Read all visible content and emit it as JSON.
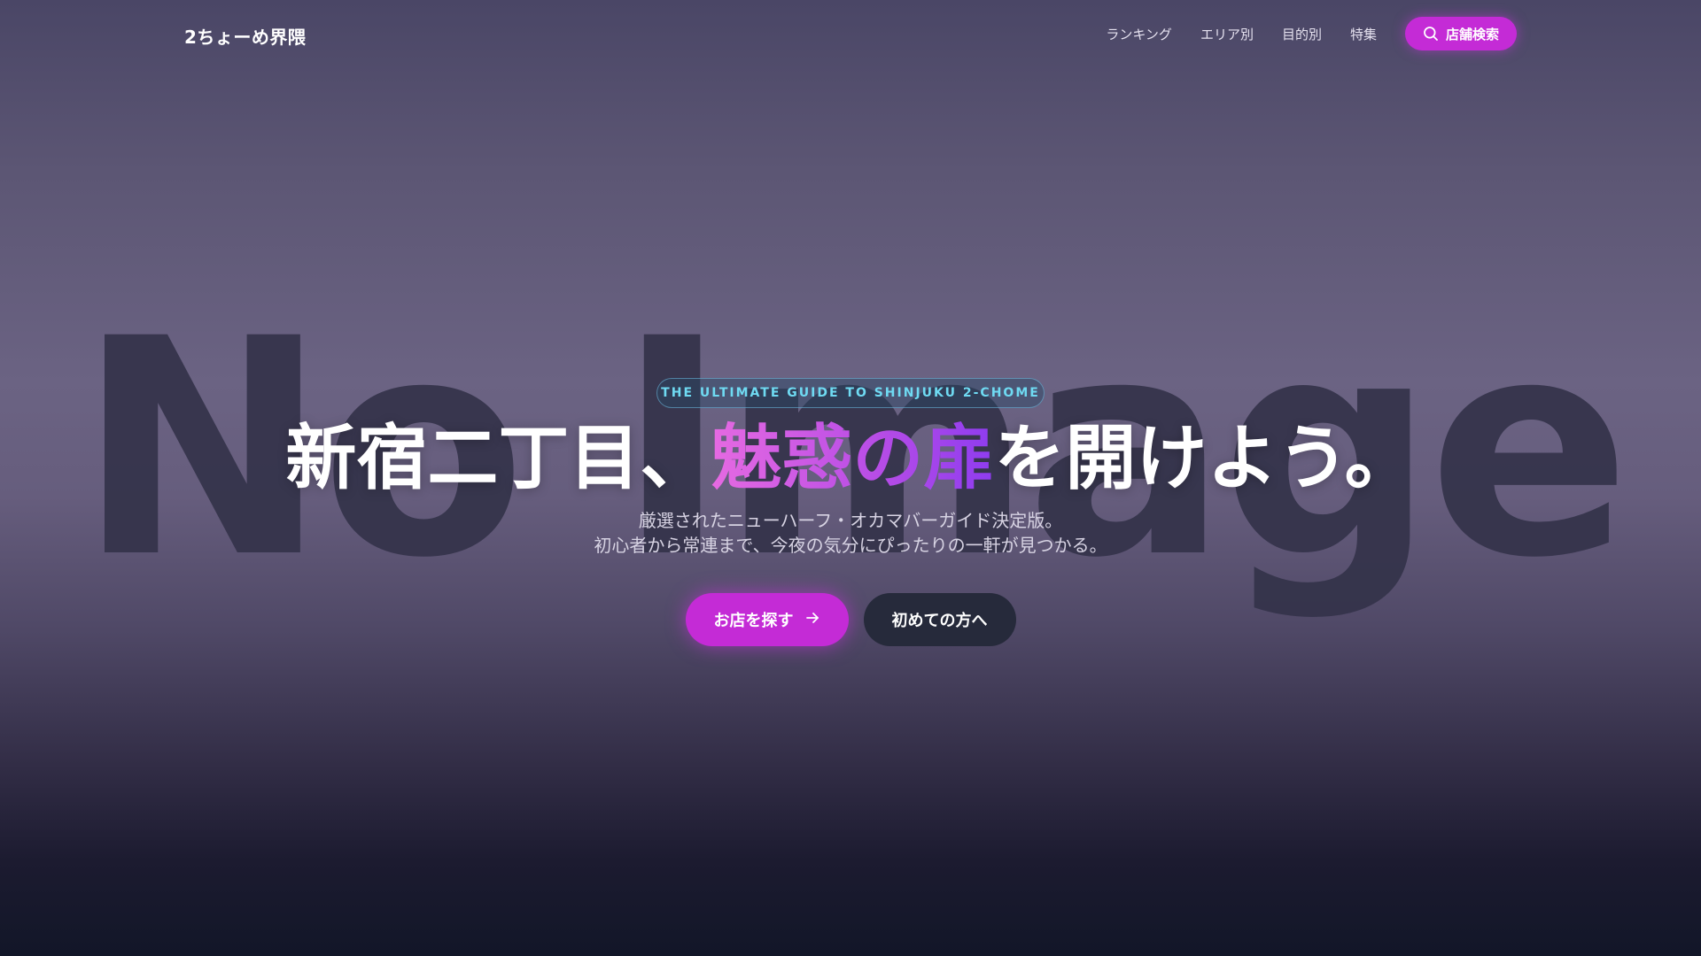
{
  "header": {
    "logo": "2ちょーめ界隈",
    "nav": [
      {
        "label": "ランキング"
      },
      {
        "label": "エリア別"
      },
      {
        "label": "目的別"
      },
      {
        "label": "特集"
      }
    ],
    "search_button": {
      "label": "店舗検索",
      "icon": "search-icon"
    }
  },
  "hero": {
    "background_placeholder": "No Image",
    "badge": "THE ULTIMATE GUIDE TO SHINJUKU 2-CHOME",
    "headline": {
      "before": "新宿二丁目、",
      "accent": "魅惑の扉",
      "after": "を開けよう。"
    },
    "subtitle": [
      "厳選されたニューハーフ・オカマバーガイド決定版。",
      "初心者から常連まで、今夜の気分にぴったりの一軒が見つかる。"
    ],
    "primary_cta": {
      "label": "お店を探す",
      "icon": "arrow-right-icon"
    },
    "secondary_cta": {
      "label": "初めての方へ"
    }
  },
  "colors": {
    "accent": "#c42bd6",
    "badge_text": "#6fdaf2",
    "secondary_button": "#262a3b"
  }
}
